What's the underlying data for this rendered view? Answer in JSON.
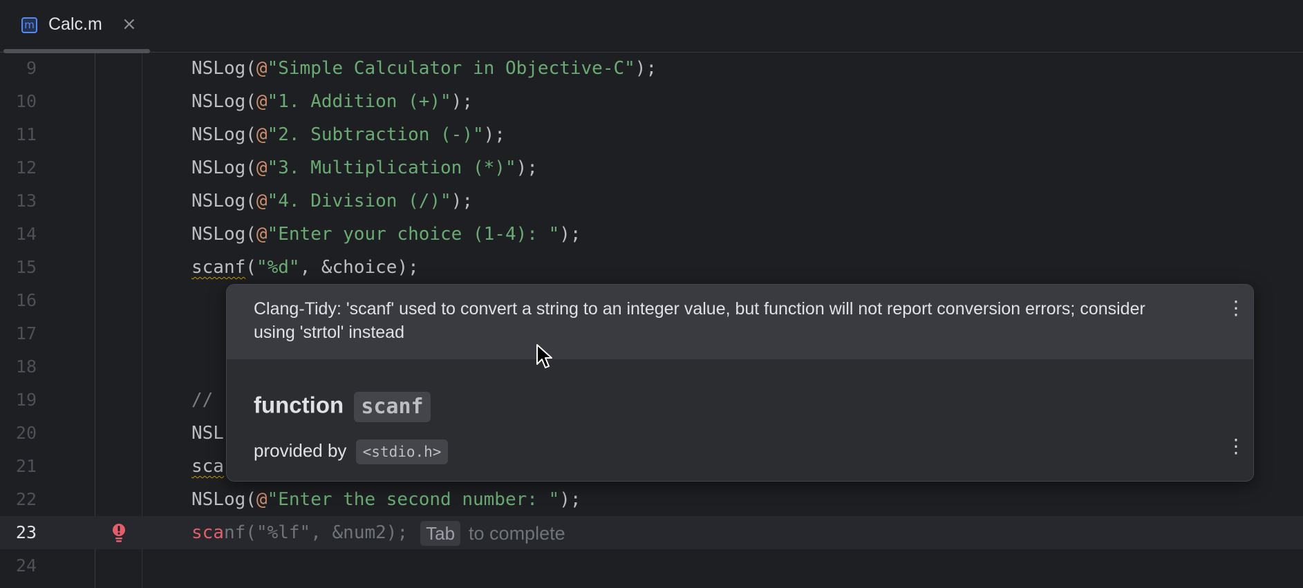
{
  "tab": {
    "icon": "m",
    "label": "Calc.m",
    "close": "×"
  },
  "lines": [
    {
      "n": "9",
      "pre": "NSLog(",
      "at": "@",
      "str": "\"Simple Calculator in Objective-C\"",
      "post": ");"
    },
    {
      "n": "10",
      "pre": "NSLog(",
      "at": "@",
      "str": "\"1. Addition (+)\"",
      "post": ");"
    },
    {
      "n": "11",
      "pre": "NSLog(",
      "at": "@",
      "str": "\"2. Subtraction (-)\"",
      "post": ");"
    },
    {
      "n": "12",
      "pre": "NSLog(",
      "at": "@",
      "str": "\"3. Multiplication (*)\"",
      "post": ");"
    },
    {
      "n": "13",
      "pre": "NSLog(",
      "at": "@",
      "str": "\"4. Division (/)\"",
      "post": ");"
    },
    {
      "n": "14",
      "pre": "NSLog(",
      "at": "@",
      "str": "\"Enter your choice (1-4): \"",
      "post": ");"
    },
    {
      "n": "15",
      "fn": "scanf",
      "pre": "(",
      "str": "\"%d\"",
      "post": ", &choice);"
    },
    {
      "n": "16"
    },
    {
      "n": "17"
    },
    {
      "n": "18"
    },
    {
      "n": "19",
      "cmt": "//"
    },
    {
      "n": "20",
      "pre": "NSL"
    },
    {
      "n": "21",
      "fn": "sca"
    },
    {
      "n": "22",
      "pre": "NSLog(",
      "at": "@",
      "str": "\"Enter the second number: \"",
      "post": ");"
    },
    {
      "n": "23",
      "typed": "sca",
      "ghost_fn": "nf(",
      "str": "\"%lf\"",
      "post": ", &num2);",
      "hint_key": "Tab",
      "hint_text": "to complete"
    },
    {
      "n": "24"
    }
  ],
  "popup": {
    "message": "Clang-Tidy: 'scanf' used to convert a string to an integer value, but function will not report conversion errors; consider using 'strtol' instead",
    "doc_kind": "function",
    "doc_name": "scanf",
    "provided_by": "provided by",
    "header": "<stdio.h>",
    "menu_icon": "more-vertical-icon"
  },
  "icons": {
    "gutter": "error-bulb-icon",
    "pointer": "mouse-cursor-icon"
  },
  "colors": {
    "background": "#1e1f22",
    "string": "#6aab73",
    "at_sign": "#cf8e6d",
    "error": "#e35e6a",
    "accent": "#548af7"
  }
}
